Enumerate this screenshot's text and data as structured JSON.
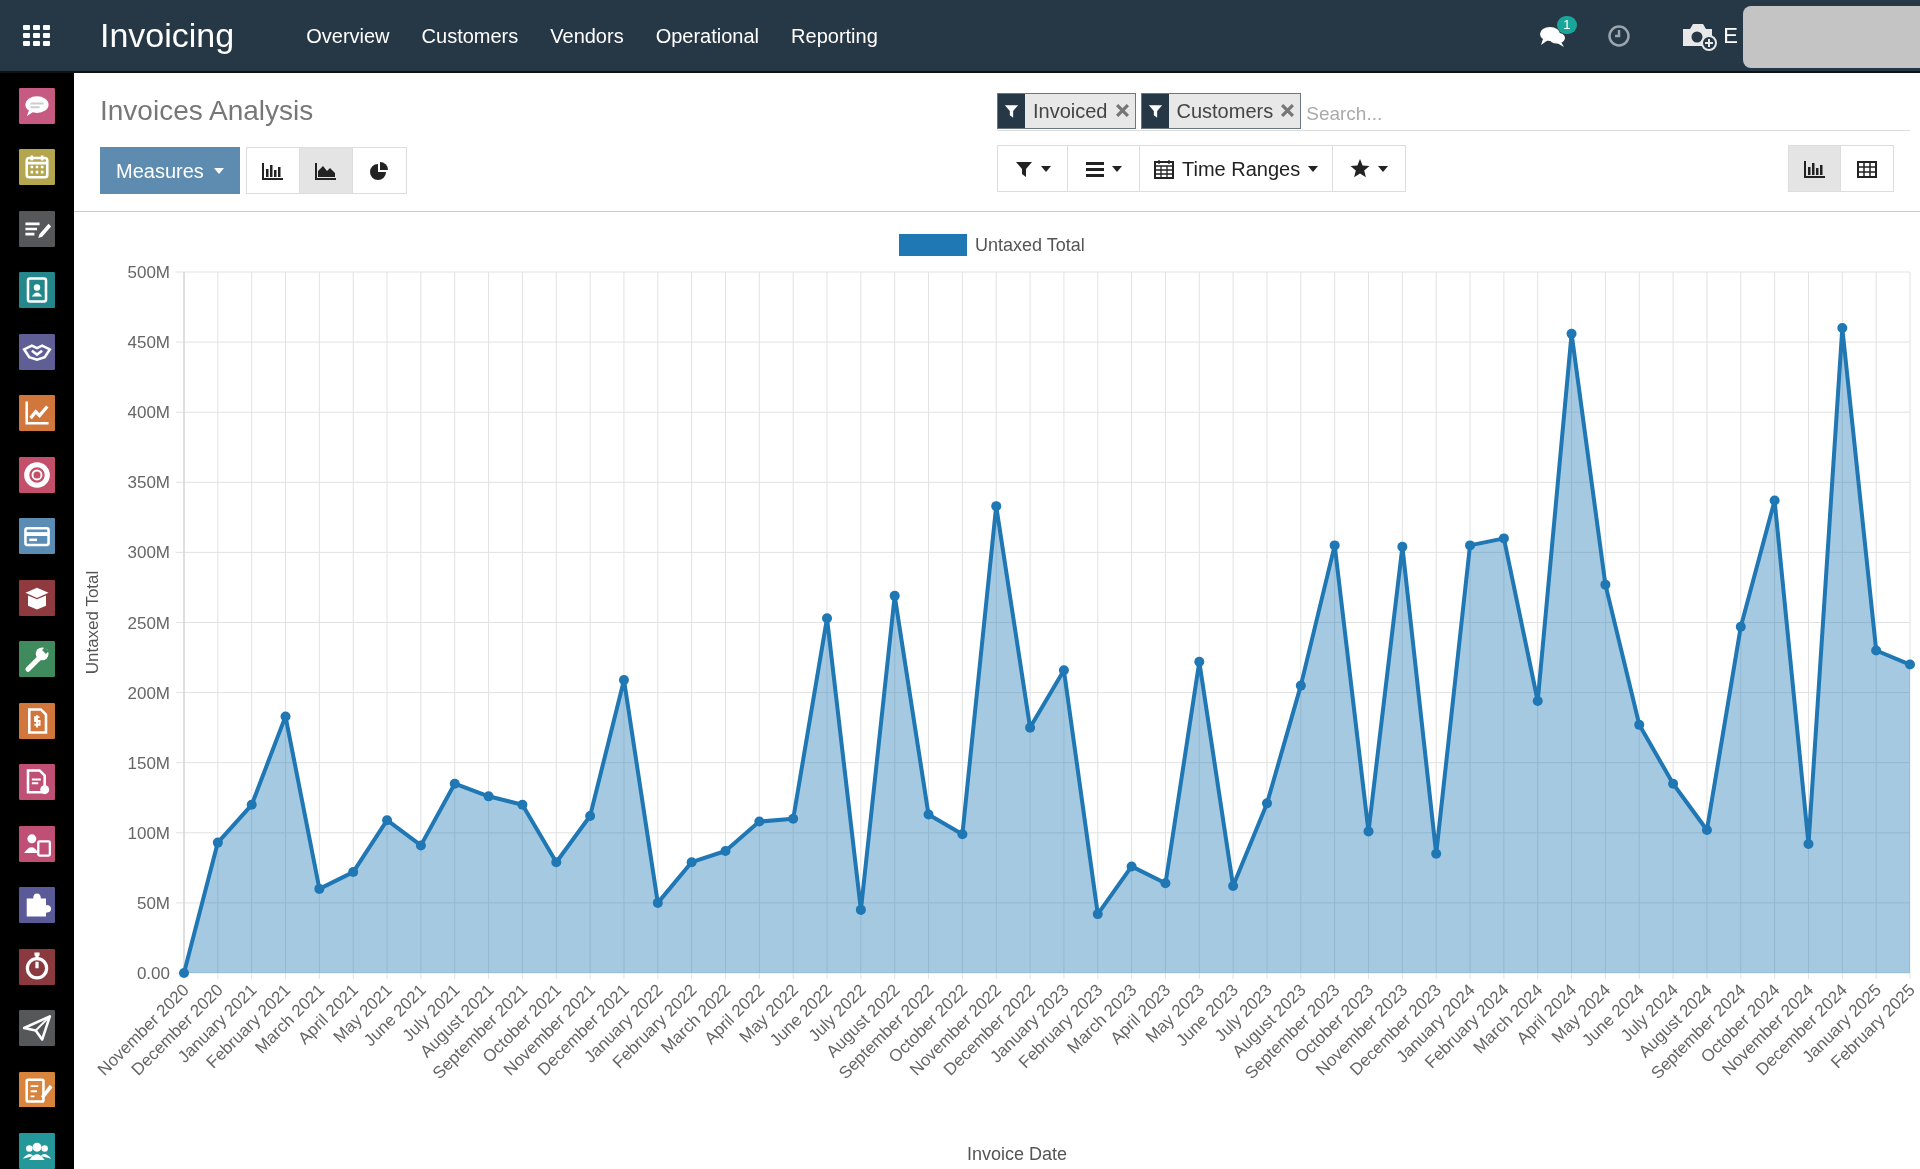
{
  "app_title": "Invoicing",
  "menu": [
    {
      "label": "Overview"
    },
    {
      "label": "Customers"
    },
    {
      "label": "Vendors"
    },
    {
      "label": "Operational"
    },
    {
      "label": "Reporting"
    }
  ],
  "systray": {
    "messages_count": "1",
    "user_initial": "E"
  },
  "sidebar": {
    "apps": [
      {
        "color": "#c65a80"
      },
      {
        "color": "#b3a64e"
      },
      {
        "color": "#555759"
      },
      {
        "color": "#23878b"
      },
      {
        "color": "#5f5f96"
      },
      {
        "color": "#d2773b"
      },
      {
        "color": "#c44f6b"
      },
      {
        "color": "#5b8db4"
      },
      {
        "color": "#8e3a3f"
      },
      {
        "color": "#3f8b5d"
      },
      {
        "color": "#d2773b"
      },
      {
        "color": "#c04f76"
      },
      {
        "color": "#c04f76"
      },
      {
        "color": "#5a5a98"
      },
      {
        "color": "#8a3a3f"
      },
      {
        "color": "#555759"
      },
      {
        "color": "#d8843c"
      },
      {
        "color": "#23979a"
      }
    ]
  },
  "page_title": "Invoices Analysis",
  "measures_button": "Measures",
  "chart_types": [
    {
      "kind": "bar",
      "selected": false
    },
    {
      "kind": "line",
      "selected": true
    },
    {
      "kind": "pie",
      "selected": false
    }
  ],
  "facets": [
    {
      "label": "Invoiced"
    },
    {
      "label": "Customers"
    }
  ],
  "search": {
    "placeholder": "Search..."
  },
  "time_ranges_button": "Time Ranges",
  "views": [
    {
      "kind": "graph",
      "selected": true
    },
    {
      "kind": "pivot",
      "selected": false
    }
  ],
  "chart_data": {
    "type": "area",
    "grid": true,
    "xlabel": "Invoice Date",
    "ylabel": "Untaxed Total",
    "ylim": [
      0,
      500000000
    ],
    "yticks": [
      {
        "value": 0,
        "label": "0.00"
      },
      {
        "value": 50000000,
        "label": "50M"
      },
      {
        "value": 100000000,
        "label": "100M"
      },
      {
        "value": 150000000,
        "label": "150M"
      },
      {
        "value": 200000000,
        "label": "200M"
      },
      {
        "value": 250000000,
        "label": "250M"
      },
      {
        "value": 300000000,
        "label": "300M"
      },
      {
        "value": 350000000,
        "label": "350M"
      },
      {
        "value": 400000000,
        "label": "400M"
      },
      {
        "value": 450000000,
        "label": "450M"
      },
      {
        "value": 500000000,
        "label": "500M"
      }
    ],
    "categories": [
      "November 2020",
      "December 2020",
      "January 2021",
      "February 2021",
      "March 2021",
      "April 2021",
      "May 2021",
      "June 2021",
      "July 2021",
      "August 2021",
      "September 2021",
      "October 2021",
      "November 2021",
      "December 2021",
      "January 2022",
      "February 2022",
      "March 2022",
      "April 2022",
      "May 2022",
      "June 2022",
      "July 2022",
      "August 2022",
      "September 2022",
      "October 2022",
      "November 2022",
      "December 2022",
      "January 2023",
      "February 2023",
      "March 2023",
      "April 2023",
      "May 2023",
      "June 2023",
      "July 2023",
      "August 2023",
      "September 2023",
      "October 2023",
      "November 2023",
      "December 2023",
      "January 2024",
      "February 2024",
      "March 2024",
      "April 2024",
      "May 2024",
      "June 2024",
      "July 2024",
      "August 2024",
      "September 2024",
      "October 2024",
      "November 2024",
      "December 2024",
      "January 2025",
      "February 2025"
    ],
    "series": [
      {
        "name": "Untaxed Total",
        "color": "#1f77b4",
        "values": [
          0,
          93000000,
          120000000,
          183000000,
          60000000,
          72000000,
          109000000,
          91000000,
          135000000,
          126000000,
          120000000,
          79000000,
          112000000,
          209000000,
          50000000,
          79000000,
          87000000,
          108000000,
          110000000,
          253000000,
          45000000,
          269000000,
          113000000,
          99000000,
          333000000,
          175000000,
          216000000,
          42000000,
          76000000,
          64000000,
          222000000,
          62000000,
          121000000,
          205000000,
          305000000,
          101000000,
          304000000,
          85000000,
          305000000,
          310000000,
          194000000,
          456000000,
          277000000,
          177000000,
          135000000,
          102000000,
          247000000,
          337000000,
          92000000,
          460000000,
          230000000,
          220000000
        ]
      }
    ]
  }
}
